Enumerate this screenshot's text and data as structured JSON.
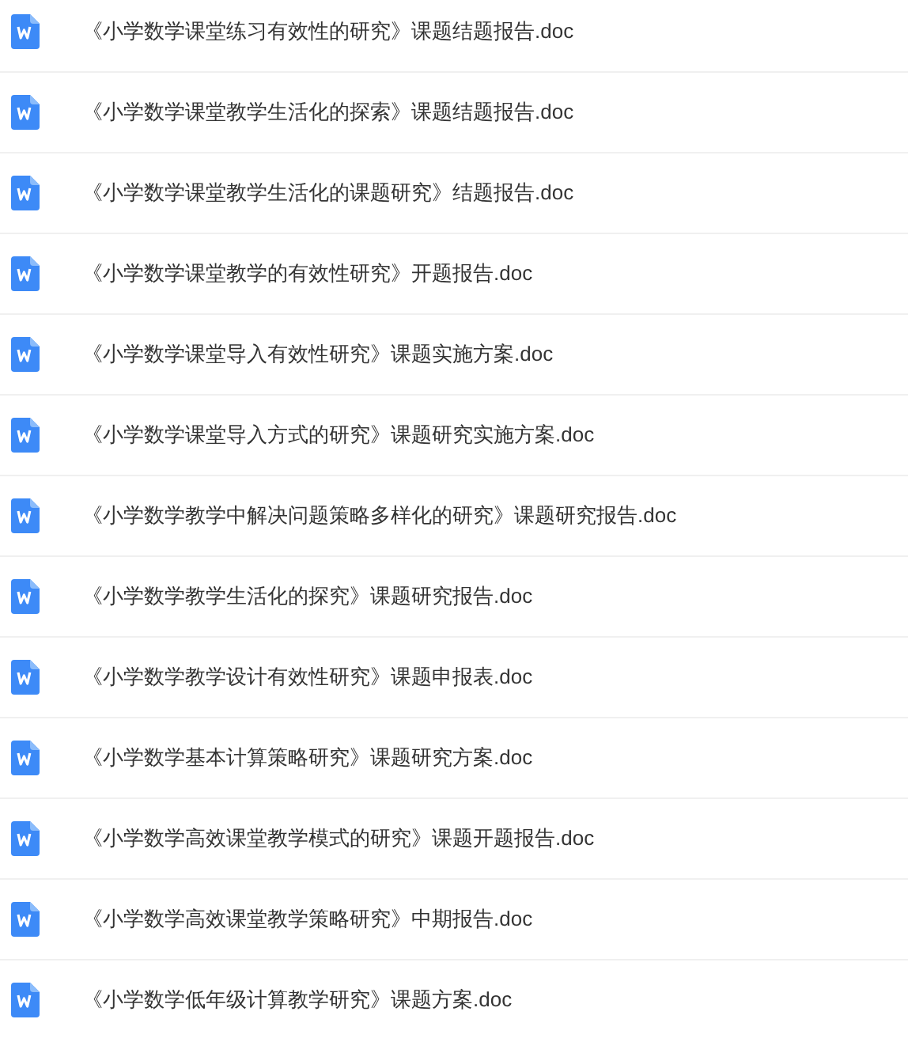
{
  "files": [
    {
      "name": "《小学数学课堂练习有效性的研究》课题结题报告.doc"
    },
    {
      "name": "《小学数学课堂教学生活化的探索》课题结题报告.doc"
    },
    {
      "name": "《小学数学课堂教学生活化的课题研究》结题报告.doc"
    },
    {
      "name": "《小学数学课堂教学的有效性研究》开题报告.doc"
    },
    {
      "name": "《小学数学课堂导入有效性研究》课题实施方案.doc"
    },
    {
      "name": "《小学数学课堂导入方式的研究》课题研究实施方案.doc"
    },
    {
      "name": "《小学数学教学中解决问题策略多样化的研究》课题研究报告.doc"
    },
    {
      "name": "《小学数学教学生活化的探究》课题研究报告.doc"
    },
    {
      "name": "《小学数学教学设计有效性研究》课题申报表.doc"
    },
    {
      "name": "《小学数学基本计算策略研究》课题研究方案.doc"
    },
    {
      "name": "《小学数学高效课堂教学模式的研究》课题开题报告.doc"
    },
    {
      "name": "《小学数学高效课堂教学策略研究》中期报告.doc"
    },
    {
      "name": "《小学数学低年级计算教学研究》课题方案.doc"
    }
  ]
}
